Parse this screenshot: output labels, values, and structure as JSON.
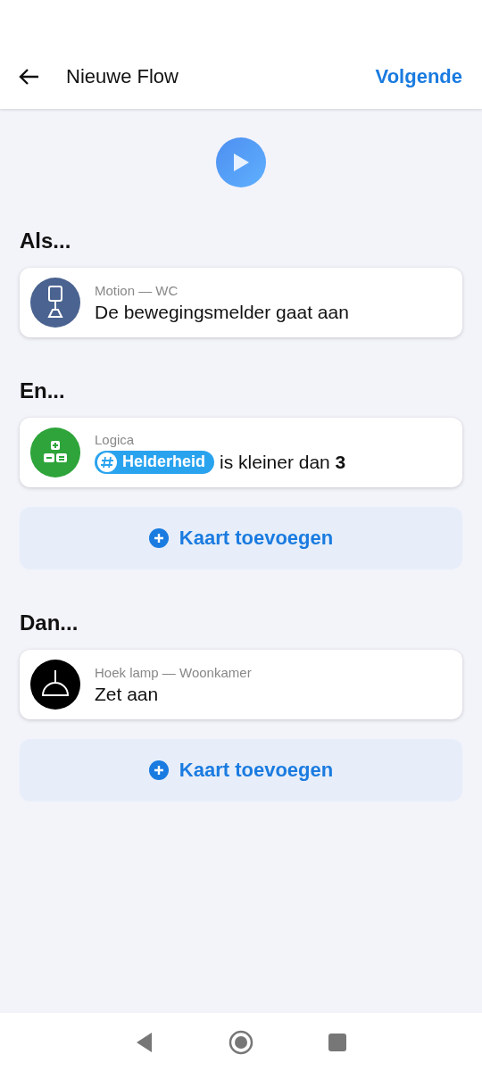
{
  "header": {
    "title": "Nieuwe Flow",
    "action": "Volgende"
  },
  "sections": [
    {
      "title": "Als...",
      "cards": [
        {
          "kind": "trigger",
          "subtitle": "Motion — WC",
          "text": "De bewegingsmelder gaat aan"
        }
      ]
    },
    {
      "title": "En...",
      "cards": [
        {
          "kind": "condition",
          "subtitle": "Logica",
          "token": "Helderheid",
          "text": "is kleiner dan **3**"
        }
      ],
      "add_button": "Kaart toevoegen"
    },
    {
      "title": "Dan...",
      "cards": [
        {
          "kind": "action",
          "subtitle": "Hoek lamp — Woonkamer",
          "text": "Zet aan"
        }
      ],
      "add_button": "Kaart toevoegen"
    }
  ]
}
